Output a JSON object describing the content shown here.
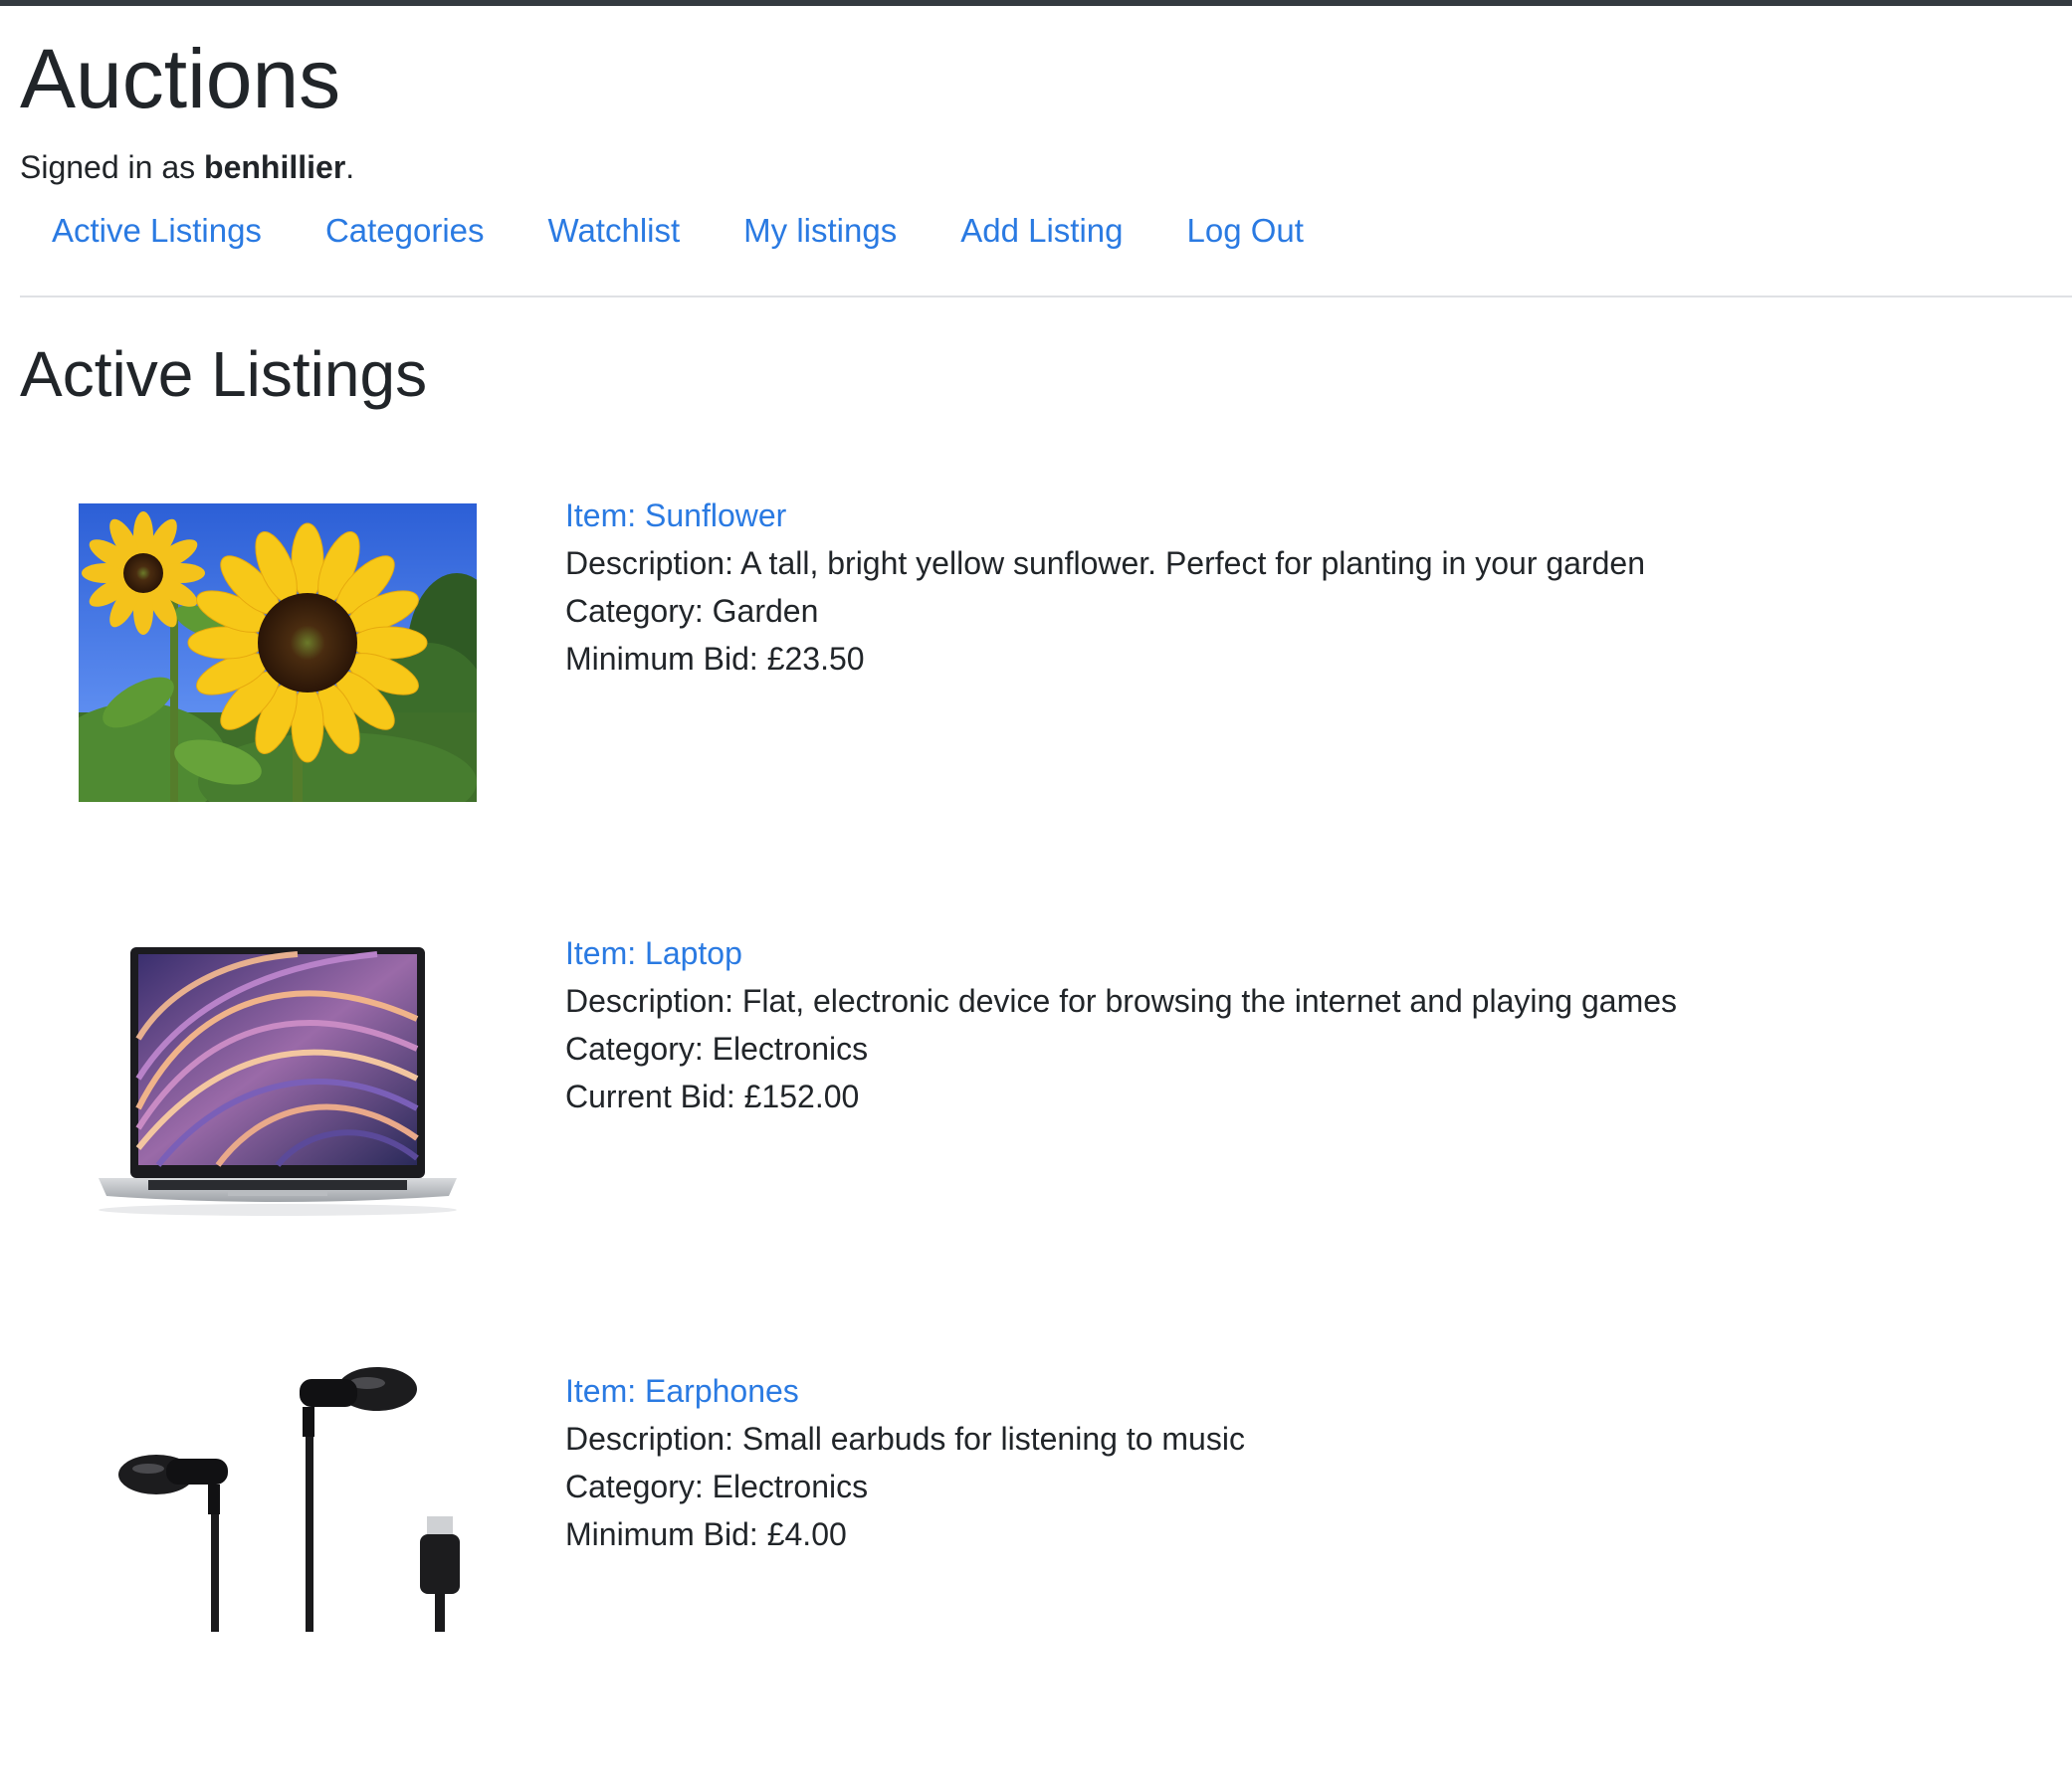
{
  "header": {
    "app_title": "Auctions",
    "signed_in_prefix": "Signed in as ",
    "username": "benhillier",
    "signed_in_suffix": "."
  },
  "nav": [
    {
      "label": "Active Listings"
    },
    {
      "label": "Categories"
    },
    {
      "label": "Watchlist"
    },
    {
      "label": "My listings"
    },
    {
      "label": "Add Listing"
    },
    {
      "label": "Log Out"
    }
  ],
  "main": {
    "title": "Active Listings",
    "listings": [
      {
        "item": "Item: Sunflower",
        "description": "Description: A tall, bright yellow sunflower. Perfect for planting in your garden",
        "category": "Category: Garden",
        "bid": "Minimum Bid: £23.50",
        "image": "sunflower-photo"
      },
      {
        "item": "Item: Laptop",
        "description": "Description: Flat, electronic device for browsing the internet and playing games",
        "category": "Category: Electronics",
        "bid": "Current Bid: £152.00",
        "image": "laptop-photo"
      },
      {
        "item": "Item: Earphones",
        "description": "Description: Small earbuds for listening to music",
        "category": "Category: Electronics",
        "bid": "Minimum Bid: £4.00",
        "image": "earphones-photo"
      }
    ]
  },
  "colors": {
    "link": "#2a7ae2",
    "text": "#212529",
    "topbar": "#343a40",
    "divider": "#dfe1e4"
  }
}
